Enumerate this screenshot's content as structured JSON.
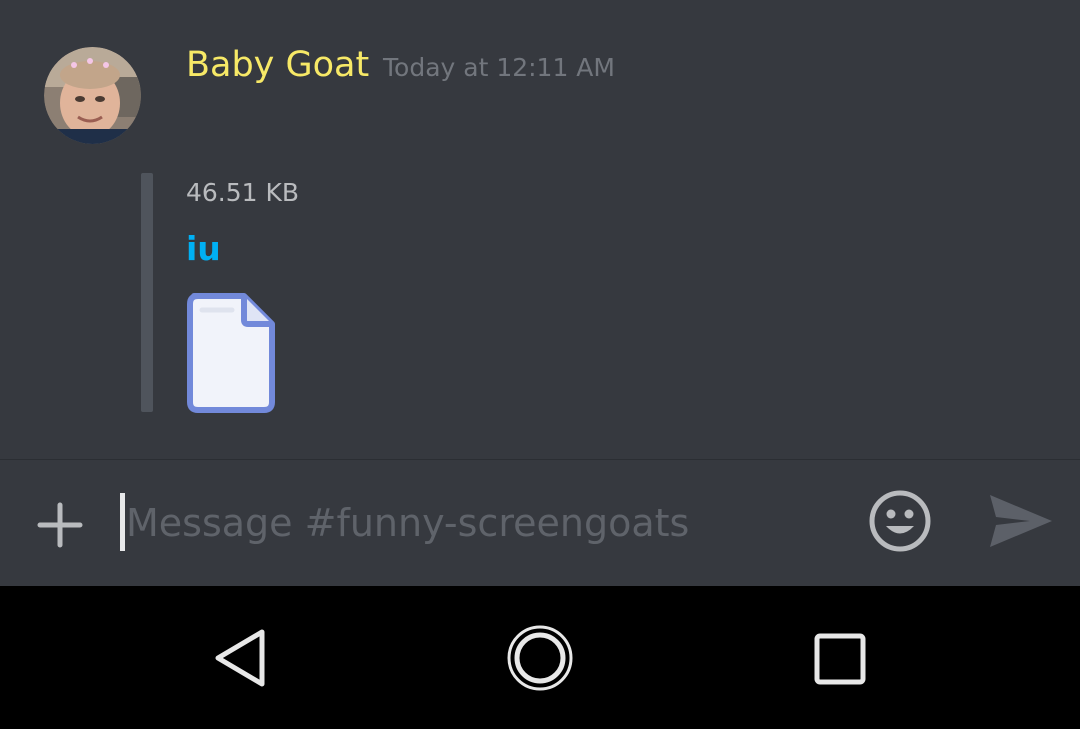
{
  "message": {
    "author": "Baby Goat",
    "timestamp": "Today at 12:11 AM",
    "author_color": "#f7e967",
    "attachment": {
      "size": "46.51 KB",
      "name": "iu",
      "link_color": "#00b0f4",
      "icon": "file-icon"
    }
  },
  "composer": {
    "placeholder": "Message #funny-screengoats",
    "value": "",
    "add_icon": "plus-icon",
    "emoji_icon": "smiley-face-icon",
    "send_icon": "send-arrow-icon"
  },
  "navbar": {
    "back_icon": "triangle-back-icon",
    "home_icon": "circle-home-icon",
    "recents_icon": "square-recents-icon"
  },
  "colors": {
    "background": "#36393f",
    "navbar": "#000000",
    "icon_gray": "#b9bbbe"
  }
}
